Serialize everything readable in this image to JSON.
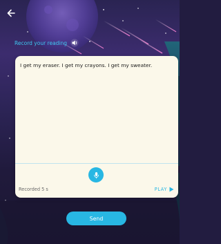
{
  "header": {
    "back_icon": "back-arrow-icon",
    "record_label": "Record your reading",
    "speaker_icon": "speaker-icon"
  },
  "reading": {
    "text": "I get my eraser. I get my crayons. I get my sweater."
  },
  "recorder": {
    "mic_icon": "microphone-icon",
    "status": "Recorded 5 s",
    "play_label": "PLAY",
    "play_icon": "play-triangle-icon"
  },
  "footer": {
    "send_label": "Send"
  },
  "colors": {
    "accent": "#28b7e3",
    "card_background": "#fbf8ea",
    "background_dark": "#221c40",
    "background_purple": "#3c2c6e"
  }
}
